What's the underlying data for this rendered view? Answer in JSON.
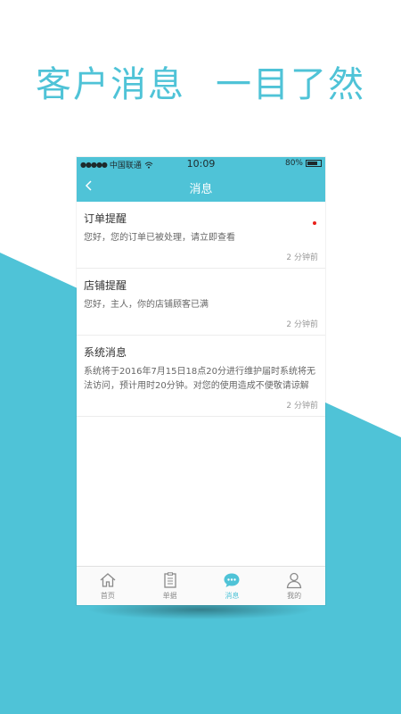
{
  "headline": {
    "part1": "客户消息",
    "part2": "一目了然"
  },
  "status_bar": {
    "signal": "●●●●●",
    "carrier": "中国联通",
    "time": "10:09",
    "battery": "80%",
    "battery_level": 0.8
  },
  "nav": {
    "title": "消息"
  },
  "messages": [
    {
      "title": "订单提醒",
      "body": "您好，您的订单已被处理，请立即查看",
      "time": "2 分钟前",
      "unread": true
    },
    {
      "title": "店铺提醒",
      "body": "您好，主人，你的店铺顾客已满",
      "time": "2 分钟前",
      "unread": false
    },
    {
      "title": "系统消息",
      "body": "系统将于2016年7月15日18点20分进行维护届时系统将无法访问，预计用时20分钟。对您的使用造成不便敬请谅解",
      "time": "2 分钟前",
      "unread": false
    }
  ],
  "tabs": [
    {
      "label": "首页",
      "icon": "home-icon",
      "active": false
    },
    {
      "label": "单据",
      "icon": "clipboard-icon",
      "active": false
    },
    {
      "label": "消息",
      "icon": "chat-bubble-icon",
      "active": true
    },
    {
      "label": "我的",
      "icon": "user-icon",
      "active": false
    }
  ],
  "colors": {
    "accent": "#4fc3d7",
    "unread_dot": "#e8201a",
    "background": "#ffffff"
  }
}
